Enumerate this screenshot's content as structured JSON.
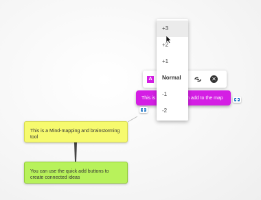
{
  "nodes": {
    "yellow": "This is a Mind-mapping and brainstorming tool",
    "green": "You can use the quick add buttons to create connected ideas",
    "magenta": "This is a node you can add to the map"
  },
  "toolbar": {
    "text_icon": "A",
    "link_icon": "link-icon",
    "close_icon": "close-icon"
  },
  "font_size_menu": {
    "items": [
      "+3",
      "+2",
      "+1",
      "Normal",
      "-1",
      "-2"
    ],
    "highlighted": "+3"
  },
  "colors": {
    "yellow_node": "#f6fa6e",
    "green_node": "#b8f25b",
    "magenta_node": "#d41ee4",
    "add_button": "#2a7cc7"
  }
}
